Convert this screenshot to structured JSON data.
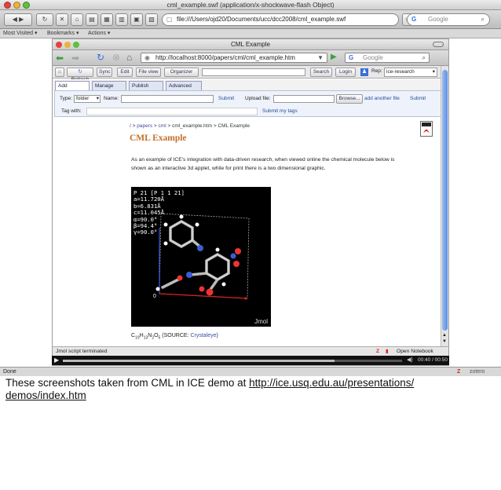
{
  "outer": {
    "title": "cml_example.swf (application/x-shockwave-flash Object)",
    "url": "file:///Users/ojd20/Documents/ucc/dcc2008/cml_example.swf",
    "search_placeholder": "Google",
    "bookmarks": [
      "Most Visited ▾",
      "Bookmarks ▾",
      "Actions ▾"
    ],
    "status": "Done",
    "zotero": "zotero"
  },
  "inner": {
    "title": "CML Example",
    "url": "http://localhost:8000/papers/cml/cml_example.htm",
    "search_placeholder": "Google",
    "ice_toolbar": {
      "refresh": "Refresh",
      "sync": "Sync",
      "edit": "Edit",
      "file_view": "File view",
      "organizer": "Organizer",
      "search": "Search",
      "login": "Login",
      "rep_label": "Rep:",
      "rep_value": "ice-research"
    },
    "tabs": [
      "Add",
      "Manage",
      "Publish",
      "Advanced"
    ],
    "panel": {
      "type_label": "Type:",
      "type_value": "folder",
      "name_label": "Name:",
      "submit": "Submit",
      "upload_label": "Upload file:",
      "browse": "Browse...",
      "add_another": "add another file",
      "submit2": "Submit",
      "tag_label": "Tag with:",
      "submit_tags": "Submit my tags"
    },
    "breadcrumb": {
      "root": "/",
      "sep": ">",
      "papers": "papers",
      "cml": "cml",
      "file": "cml_example.htm",
      "current": "CML Example"
    },
    "page_title": "CML Example",
    "intro": "As an example of ICE's integration with data-driven research, when viewed online the chemical molecule below is shown as an interactive 3d applet, while for print there is a two dimensional graphic.",
    "jmol_readout": "P 21 [P 1 1 21]\na=11.720Å\nb=6.831Å\nc=11.045Å\nα=90.0°\nβ=94.4°\nγ=90.0°",
    "jmol_origin": "0",
    "jmol_label": "Jmol",
    "formula": {
      "c": "C",
      "c_sub": "19",
      "h": "H",
      "h_sub": "13",
      "n": "N",
      "n_sub": "2",
      "o": "O",
      "o_sub": "5",
      "source_prefix": "(SOURCE: ",
      "source_link": "Crystaleye",
      "source_suffix": ")"
    },
    "status": "Jmol script terminated",
    "open_notebook": "Open Notebook"
  },
  "flash": {
    "time": "00:40 / 00:50",
    "progress": 0.8
  },
  "caption": {
    "text": "These screenshots taken from CML in ICE demo at ",
    "link_line1": "http://ice.usq.edu.au/presentations/",
    "link_line2": "demos/index.htm"
  },
  "colors": {
    "title_accent": "#c0702a",
    "link": "#3a4ea0",
    "scroll_thumb": "#5c8fe4"
  }
}
